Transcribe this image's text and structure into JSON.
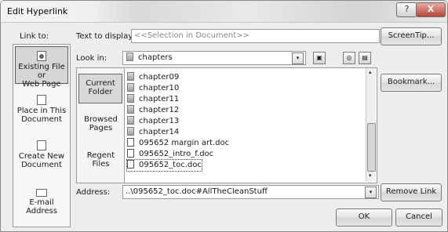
{
  "window": {
    "title": "Edit Hyperlink",
    "help_glyph": "?",
    "close_glyph": "X"
  },
  "link_to": {
    "label": "Link to:",
    "items": [
      {
        "label_line1": "Existing File or",
        "label_line2": "Web Page",
        "icon": "file-globe-icon"
      },
      {
        "label_line1": "Place in This",
        "label_line2": "Document",
        "icon": "place-icon"
      },
      {
        "label_line1": "Create New",
        "label_line2": "Document",
        "icon": "new-document-icon"
      },
      {
        "label_line1": "E-mail Address",
        "label_line2": "",
        "icon": "email-icon"
      }
    ]
  },
  "text_to_display": {
    "label": "Text to display:",
    "value": "<<Selection in Document>>"
  },
  "screentip_button": "ScreenTip...",
  "look_in": {
    "label": "Look in:",
    "value": "chapters"
  },
  "places": [
    {
      "line1": "Current",
      "line2": "Folder"
    },
    {
      "line1": "Browsed",
      "line2": "Pages"
    },
    {
      "line1": "Regent",
      "line2": "Files"
    }
  ],
  "files": [
    {
      "name": "chapter09",
      "type": "folder"
    },
    {
      "name": "chapter10",
      "type": "folder"
    },
    {
      "name": "chapter11",
      "type": "folder"
    },
    {
      "name": "chapter12",
      "type": "folder"
    },
    {
      "name": "chapter13",
      "type": "folder"
    },
    {
      "name": "chapter14",
      "type": "folder"
    },
    {
      "name": "095652 margin art.doc",
      "type": "doc"
    },
    {
      "name": "095652_intro_f.doc",
      "type": "doc"
    },
    {
      "name": "095652_toc.doc",
      "type": "doc"
    }
  ],
  "bookmark_button": "Bookmark...",
  "address": {
    "label": "Address:",
    "value": "..\\095652_toc.doc#AllTheCleanStuff"
  },
  "remove_link_button": "Remove Link",
  "ok_button": "OK",
  "cancel_button": "Cancel",
  "icons": {
    "dropdown": "▾",
    "scroll_up": "▴",
    "scroll_down": "▾"
  }
}
